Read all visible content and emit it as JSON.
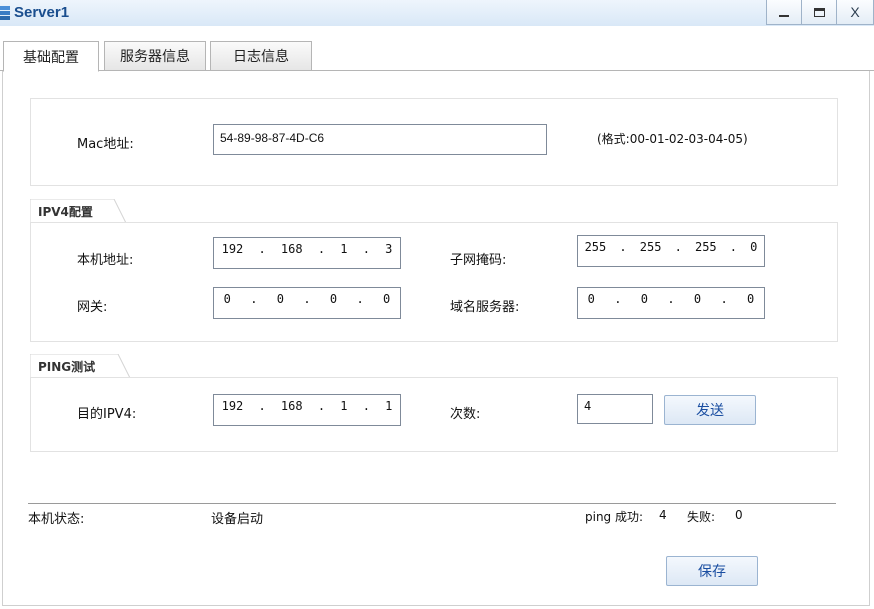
{
  "window": {
    "title": "Server1",
    "icon": "server-icon",
    "minimize_icon": "minimize-icon",
    "maximize_icon": "maximize-icon",
    "close_label": "X"
  },
  "tabs": [
    {
      "label": "基础配置",
      "active": true
    },
    {
      "label": "服务器信息",
      "active": false
    },
    {
      "label": "日志信息",
      "active": false
    }
  ],
  "mac": {
    "label": "Mac地址:",
    "value": "54-89-98-87-4D-C6",
    "format_hint": "(格式:00-01-02-03-04-05)"
  },
  "ipv4": {
    "section_title": "IPV4配置",
    "local_ip_label": "本机地址:",
    "local_ip": [
      "192",
      "168",
      "1",
      "3"
    ],
    "subnet_label": "子网掩码:",
    "subnet": [
      "255",
      "255",
      "255",
      "0"
    ],
    "gateway_label": "网关:",
    "gateway": [
      "0",
      "0",
      "0",
      "0"
    ],
    "dns_label": "域名服务器:",
    "dns": [
      "0",
      "0",
      "0",
      "0"
    ]
  },
  "ping": {
    "section_title": "PING测试",
    "target_label": "目的IPV4:",
    "target": [
      "192",
      "168",
      "1",
      "1"
    ],
    "count_label": "次数:",
    "count": "4",
    "send_label": "发送"
  },
  "status": {
    "label": "本机状态:",
    "value": "设备启动",
    "ping_success_label": "ping 成功:",
    "ping_success": "4",
    "fail_label": "失败:",
    "fail": "0"
  },
  "save_label": "保存",
  "colors": {
    "title": "#1a4e8e",
    "button_text": "#1a4ea1"
  }
}
